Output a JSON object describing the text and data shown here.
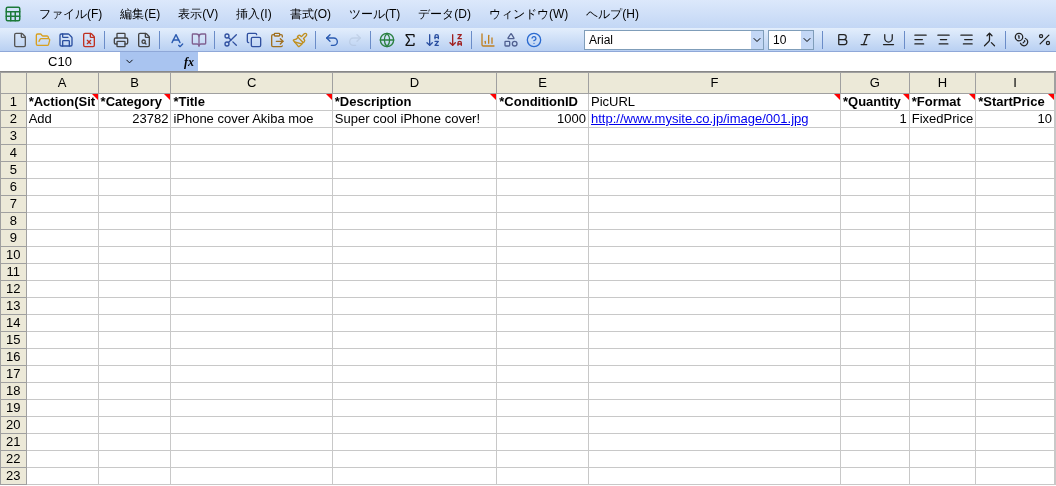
{
  "menu": [
    "ファイル(F)",
    "編集(E)",
    "表示(V)",
    "挿入(I)",
    "書式(O)",
    "ツール(T)",
    "データ(D)",
    "ウィンドウ(W)",
    "ヘルプ(H)"
  ],
  "toolbar": {
    "groups": [
      [
        {
          "kind": "new",
          "disabled": false
        },
        {
          "kind": "open",
          "disabled": false
        },
        {
          "kind": "save",
          "disabled": false
        },
        {
          "kind": "permission",
          "disabled": false
        }
      ],
      [
        {
          "kind": "print",
          "disabled": false
        },
        {
          "kind": "preview",
          "disabled": false
        }
      ],
      [
        {
          "kind": "spell",
          "disabled": false
        },
        {
          "kind": "research",
          "disabled": false
        }
      ],
      [
        {
          "kind": "cut",
          "disabled": false
        },
        {
          "kind": "copy",
          "disabled": false
        },
        {
          "kind": "paste",
          "disabled": false
        },
        {
          "kind": "brush",
          "disabled": false
        }
      ],
      [
        {
          "kind": "undo",
          "disabled": false
        },
        {
          "kind": "redo",
          "disabled": true
        }
      ],
      [
        {
          "kind": "link",
          "disabled": false
        },
        {
          "kind": "sum",
          "disabled": false
        },
        {
          "kind": "sortasc",
          "disabled": false
        },
        {
          "kind": "sortdesc",
          "disabled": false
        }
      ],
      [
        {
          "kind": "chart",
          "disabled": false
        },
        {
          "kind": "drawing",
          "disabled": false
        },
        {
          "kind": "help",
          "disabled": false
        }
      ]
    ],
    "font": "Arial",
    "size": "10"
  },
  "name_box": "C10",
  "formula_label": "fx",
  "columns": [
    "A",
    "B",
    "C",
    "D",
    "E",
    "F",
    "G",
    "H",
    "I"
  ],
  "rows": [
    {
      "number": "1",
      "cells": [
        {
          "text": "*Action(Sit",
          "bold": true,
          "kind": "text",
          "comment": true
        },
        {
          "text": "*Category",
          "bold": true,
          "kind": "text",
          "comment": true
        },
        {
          "text": "*Title",
          "bold": true,
          "kind": "text",
          "comment": true
        },
        {
          "text": "*Description",
          "bold": true,
          "kind": "text",
          "comment": true
        },
        {
          "text": "*ConditionID",
          "bold": true,
          "kind": "text",
          "comment": false
        },
        {
          "text": "PicURL",
          "bold": false,
          "kind": "text",
          "comment": true
        },
        {
          "text": "*Quantity",
          "bold": true,
          "kind": "text",
          "comment": true
        },
        {
          "text": "*Format",
          "bold": true,
          "kind": "text",
          "comment": true
        },
        {
          "text": "*StartPrice",
          "bold": true,
          "kind": "text",
          "comment": true
        }
      ]
    },
    {
      "number": "2",
      "cells": [
        {
          "text": "Add",
          "bold": false,
          "kind": "text",
          "comment": false
        },
        {
          "text": "23782",
          "bold": false,
          "kind": "number",
          "comment": false
        },
        {
          "text": "iPhone cover Akiba moe",
          "bold": false,
          "kind": "text",
          "comment": false
        },
        {
          "text": "Super cool iPhone cover!",
          "bold": false,
          "kind": "text",
          "comment": false
        },
        {
          "text": "1000",
          "bold": false,
          "kind": "number",
          "comment": false
        },
        {
          "text": "http://www.mysite.co.jp/image/001.jpg",
          "bold": false,
          "kind": "link",
          "comment": false
        },
        {
          "text": "1",
          "bold": false,
          "kind": "number",
          "comment": false
        },
        {
          "text": "FixedPrice",
          "bold": false,
          "kind": "text",
          "comment": false
        },
        {
          "text": "10",
          "bold": false,
          "kind": "number",
          "comment": false
        }
      ]
    },
    {
      "number": "3",
      "cells": []
    },
    {
      "number": "4",
      "cells": []
    },
    {
      "number": "5",
      "cells": []
    },
    {
      "number": "6",
      "cells": []
    },
    {
      "number": "7",
      "cells": []
    },
    {
      "number": "8",
      "cells": []
    },
    {
      "number": "9",
      "cells": []
    },
    {
      "number": "10",
      "cells": []
    },
    {
      "number": "11",
      "cells": []
    },
    {
      "number": "12",
      "cells": []
    },
    {
      "number": "13",
      "cells": []
    },
    {
      "number": "14",
      "cells": []
    },
    {
      "number": "15",
      "cells": []
    },
    {
      "number": "16",
      "cells": []
    },
    {
      "number": "17",
      "cells": []
    },
    {
      "number": "18",
      "cells": []
    },
    {
      "number": "19",
      "cells": []
    },
    {
      "number": "20",
      "cells": []
    },
    {
      "number": "21",
      "cells": []
    },
    {
      "number": "22",
      "cells": []
    },
    {
      "number": "23",
      "cells": []
    }
  ]
}
